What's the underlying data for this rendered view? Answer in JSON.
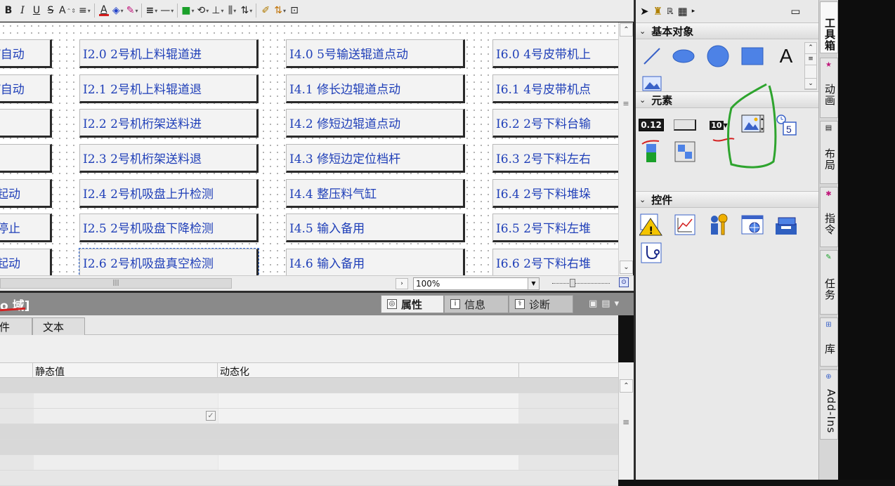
{
  "toolbar": {
    "bold": "B",
    "italic": "I",
    "underline": "U",
    "strike": "S",
    "font_size": "A",
    "align": "≡",
    "font_color": "A",
    "fill": "◈",
    "pen": "✎",
    "line_style": "≡",
    "line_dash": "—",
    "fill_color": "■",
    "rotate": "⟲",
    "align_obj": "⊥",
    "distribute": "⫼",
    "spacing": "⇅",
    "brush": "✐",
    "order": "⇅",
    "zoom_tool": "⊡",
    "font_color_hex": "#d62020",
    "fill_hex": "#2040c8",
    "pen_hex": "#c0157a",
    "fill_color_hex": "#1aa02a"
  },
  "canvas": {
    "buttons": [
      {
        "label": "/自动"
      },
      {
        "label": "/自动"
      },
      {
        "label": ""
      },
      {
        "label": ""
      },
      {
        "label": "起动"
      },
      {
        "label": "停止"
      },
      {
        "label": "起动"
      },
      {
        "label": "I2.0  2号机上料辊道进"
      },
      {
        "label": "I2.1  2号机上料辊道退"
      },
      {
        "label": "I2.2  2号机桁架送料进"
      },
      {
        "label": "I2.3  2号机桁架送料退"
      },
      {
        "label": "I2.4  2号机吸盘上升检测"
      },
      {
        "label": "I2.5  2号机吸盘下降检测"
      },
      {
        "label": "I2.6  2号机吸盘真空检测"
      },
      {
        "label": "I4.0  5号输送辊道点动"
      },
      {
        "label": "I4.1  修长边辊道点动"
      },
      {
        "label": "I4.2  修短边辊道点动"
      },
      {
        "label": "I4.3  修短边定位档杆"
      },
      {
        "label": "I4.4  整压料气缸"
      },
      {
        "label": "I4.5  输入备用"
      },
      {
        "label": "I4.6  输入备用"
      },
      {
        "label": "I6.0  4号皮带机上"
      },
      {
        "label": "I6.1  4号皮带机点"
      },
      {
        "label": "I6.2  2号下料台输"
      },
      {
        "label": "I6.3  2号下料左右"
      },
      {
        "label": "I6.4  2号下料堆垛"
      },
      {
        "label": "I6.5  2号下料左堆"
      },
      {
        "label": "I6.6  2号下料右堆"
      }
    ],
    "zoom": "100%"
  },
  "properties": {
    "title": "o 域]",
    "tabs": [
      {
        "label": "属性",
        "icon": "properties-icon"
      },
      {
        "label": "信息",
        "icon": "info-icon"
      },
      {
        "label": "诊断",
        "icon": "diagnostics-icon"
      }
    ],
    "subtabs": [
      "件",
      "文本"
    ],
    "columns": [
      "静态值",
      "动态化"
    ]
  },
  "toolbox": {
    "sections": {
      "basic": "基本对象",
      "elements": "元素",
      "controls": "控件"
    },
    "element_io_value": "0.12",
    "clock_value": "5"
  },
  "side_tabs": [
    "工具箱",
    "动画",
    "布局",
    "指令",
    "任务",
    "库",
    "Add-Ins"
  ]
}
